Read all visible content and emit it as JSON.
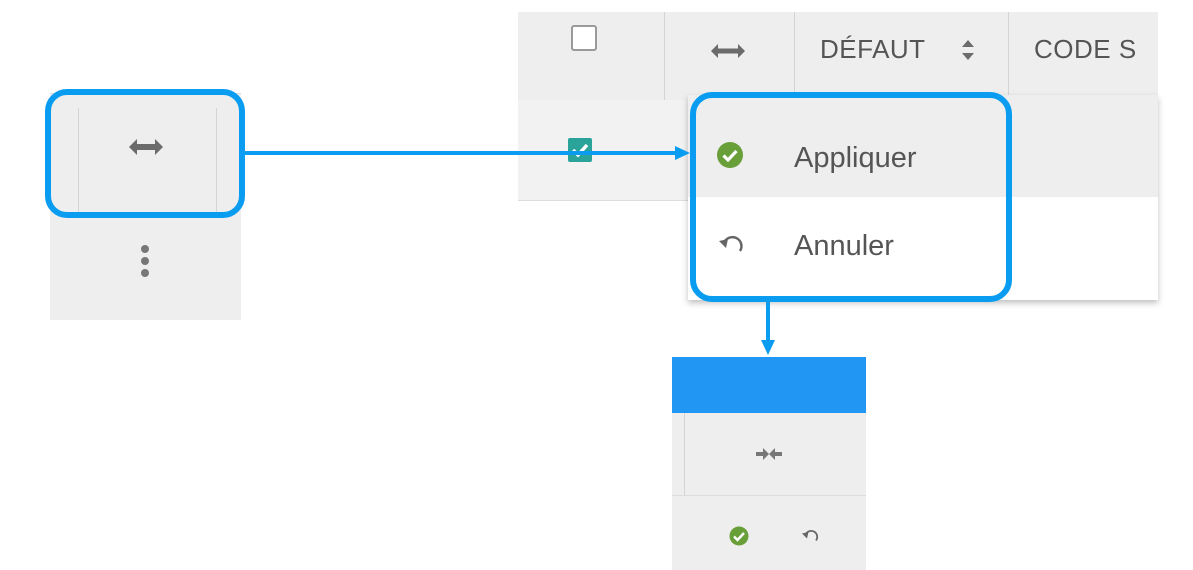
{
  "grid": {
    "columns": [
      {
        "name": "select",
        "label": ""
      },
      {
        "name": "expand",
        "label": ""
      },
      {
        "name": "default",
        "label": "DÉFAUT"
      },
      {
        "name": "code",
        "label": "CODE S"
      }
    ],
    "row": {
      "checked": true
    }
  },
  "menu": {
    "items": [
      {
        "label": "Appliquer",
        "icon": "check-circle-icon"
      },
      {
        "label": "Annuler",
        "icon": "undo-icon"
      }
    ]
  },
  "icons": {
    "expand": "expand-arrows-icon",
    "collapse": "collapse-arrows-icon",
    "more": "kebab-icon",
    "sort": "sort-icon"
  },
  "colors": {
    "callout": "#0a9cf0",
    "header_bar": "#2196f3",
    "check": "#689f38",
    "checkbox": "#2aa39a"
  }
}
